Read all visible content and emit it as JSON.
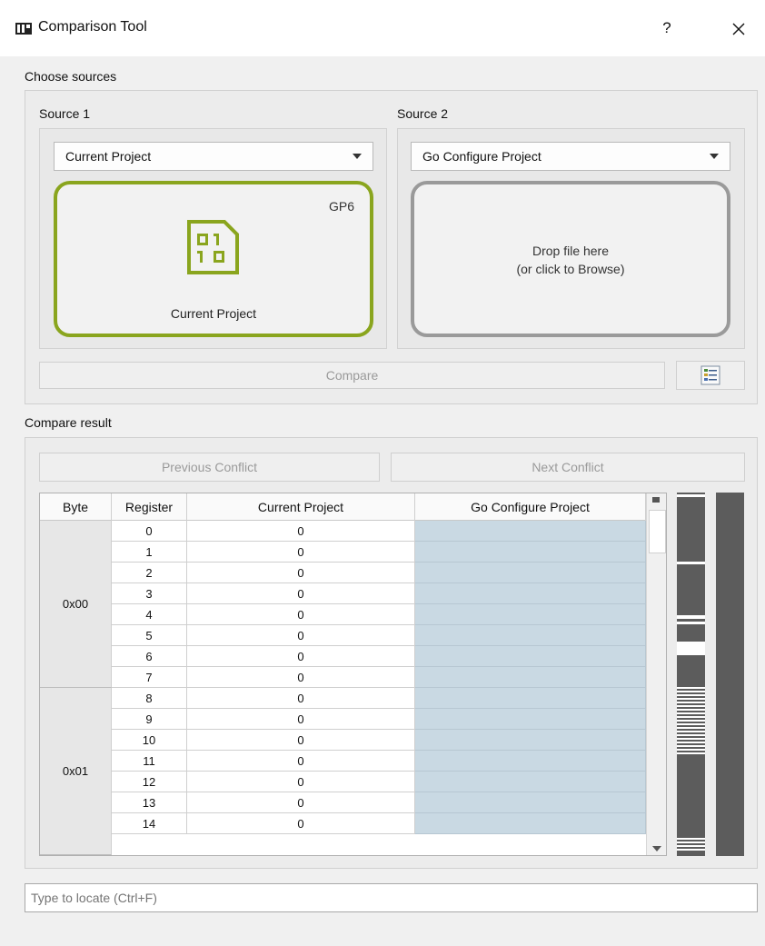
{
  "window": {
    "title": "Comparison Tool",
    "help_label": "?",
    "icon": "app-chip-icon",
    "close_icon": "close-icon"
  },
  "sources": {
    "group_label": "Choose sources",
    "source1": {
      "label": "Source 1",
      "selected": "Current Project",
      "card_tag": "GP6",
      "card_icon": "binary-file-icon",
      "card_label": "Current Project",
      "accent": "#8aa51e"
    },
    "source2": {
      "label": "Source 2",
      "selected": "Go Configure Project",
      "drop_line1": "Drop file here",
      "drop_line2": "(or click to Browse)",
      "border": "#9a9a9a"
    },
    "compare_label": "Compare",
    "options_icon": "list-settings-icon"
  },
  "result": {
    "group_label": "Compare result",
    "prev_label": "Previous Conflict",
    "next_label": "Next Conflict",
    "columns": [
      "Byte",
      "Register",
      "Current Project",
      "Go Configure Project"
    ],
    "groups": [
      {
        "byte": "0x00",
        "rows": [
          {
            "register": "0",
            "current": "0",
            "go": ""
          },
          {
            "register": "1",
            "current": "0",
            "go": ""
          },
          {
            "register": "2",
            "current": "0",
            "go": ""
          },
          {
            "register": "3",
            "current": "0",
            "go": ""
          },
          {
            "register": "4",
            "current": "0",
            "go": ""
          },
          {
            "register": "5",
            "current": "0",
            "go": ""
          },
          {
            "register": "6",
            "current": "0",
            "go": ""
          },
          {
            "register": "7",
            "current": "0",
            "go": ""
          }
        ]
      },
      {
        "byte": "0x01",
        "rows": [
          {
            "register": "8",
            "current": "0",
            "go": ""
          },
          {
            "register": "9",
            "current": "0",
            "go": ""
          },
          {
            "register": "10",
            "current": "0",
            "go": ""
          },
          {
            "register": "11",
            "current": "0",
            "go": ""
          },
          {
            "register": "12",
            "current": "0",
            "go": ""
          },
          {
            "register": "13",
            "current": "0",
            "go": ""
          },
          {
            "register": "14",
            "current": "0",
            "go": ""
          }
        ]
      }
    ],
    "go_column_color": "#c9d9e3"
  },
  "search": {
    "placeholder": "Type to locate (Ctrl+F)"
  }
}
